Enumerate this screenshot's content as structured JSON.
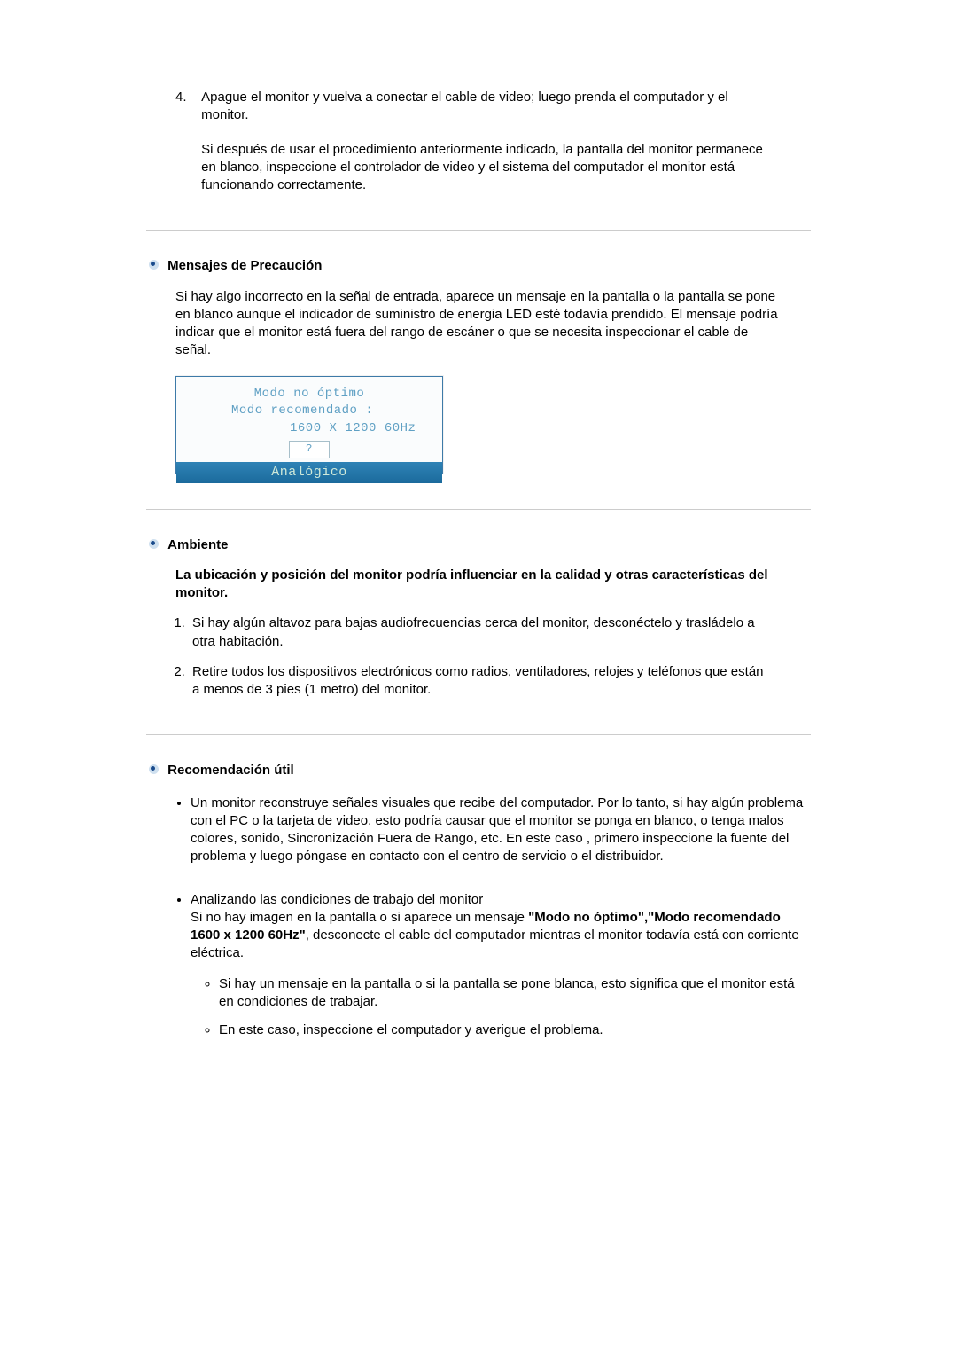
{
  "step4": {
    "number": "4.",
    "line1": "Apague el monitor y vuelva a conectar el cable de video; luego prenda el computador y el monitor.",
    "line2": "Si después de usar el procedimiento anteriormente indicado, la pantalla del monitor permanece en blanco, inspeccione el controlador de video y el sistema del computador el monitor está funcionando correctamente."
  },
  "precaution": {
    "title": "Mensajes de Precaución",
    "body": "Si hay algo incorrecto en la señal de entrada, aparece un mensaje en la pantalla o la pantalla se pone en blanco aunque el indicador de suministro de energia LED esté todavía prendido. El mensaje podría indicar que el monitor está fuera del rango de escáner o que se necesita inspeccionar el cable de señal."
  },
  "osd": {
    "l1": "Modo no óptimo",
    "l2": "Modo recomendado :",
    "l3": "1600 X 1200  60Hz",
    "btn": "?",
    "bar": "Analógico"
  },
  "ambiente": {
    "title": "Ambiente",
    "intro": "La ubicación y posición del monitor podría influenciar en la calidad y otras características del monitor.",
    "li1": "Si hay algún altavoz para bajas audiofrecuencias cerca del monitor, desconéctelo y trasládelo a otra habitación.",
    "li2": "Retire todos los dispositivos electrónicos como radios, ventiladores, relojes y teléfonos que están a menos de 3 pies (1 metro) del monitor."
  },
  "recom": {
    "title": "Recomendación útil",
    "p1": "Un monitor reconstruye señales visuales que recibe del computador. Por lo tanto, si hay algún problema con el PC o la tarjeta de video, esto podría causar que el monitor se ponga en blanco, o tenga malos colores, sonido, Sincronización Fuera de Rango, etc. En este caso , primero inspeccione la fuente del problema y luego póngase en contacto con el centro de servicio o el distribuidor.",
    "p2a": "Analizando las condiciones de trabajo del monitor",
    "p2b_pre": "Si no hay imagen en la pantalla o si aparece un mensaje ",
    "p2b_bold": "\"Modo no óptimo\",\"Modo recomendado 1600 x 1200 60Hz\"",
    "p2b_post": ", desconecte el cable del computador mientras el monitor todavía está con corriente eléctrica.",
    "s1": "Si hay un mensaje en la pantalla o si la pantalla se pone blanca, esto significa que el monitor está en condiciones de trabajar.",
    "s2": "En este caso, inspeccione el computador y averigue el problema."
  }
}
